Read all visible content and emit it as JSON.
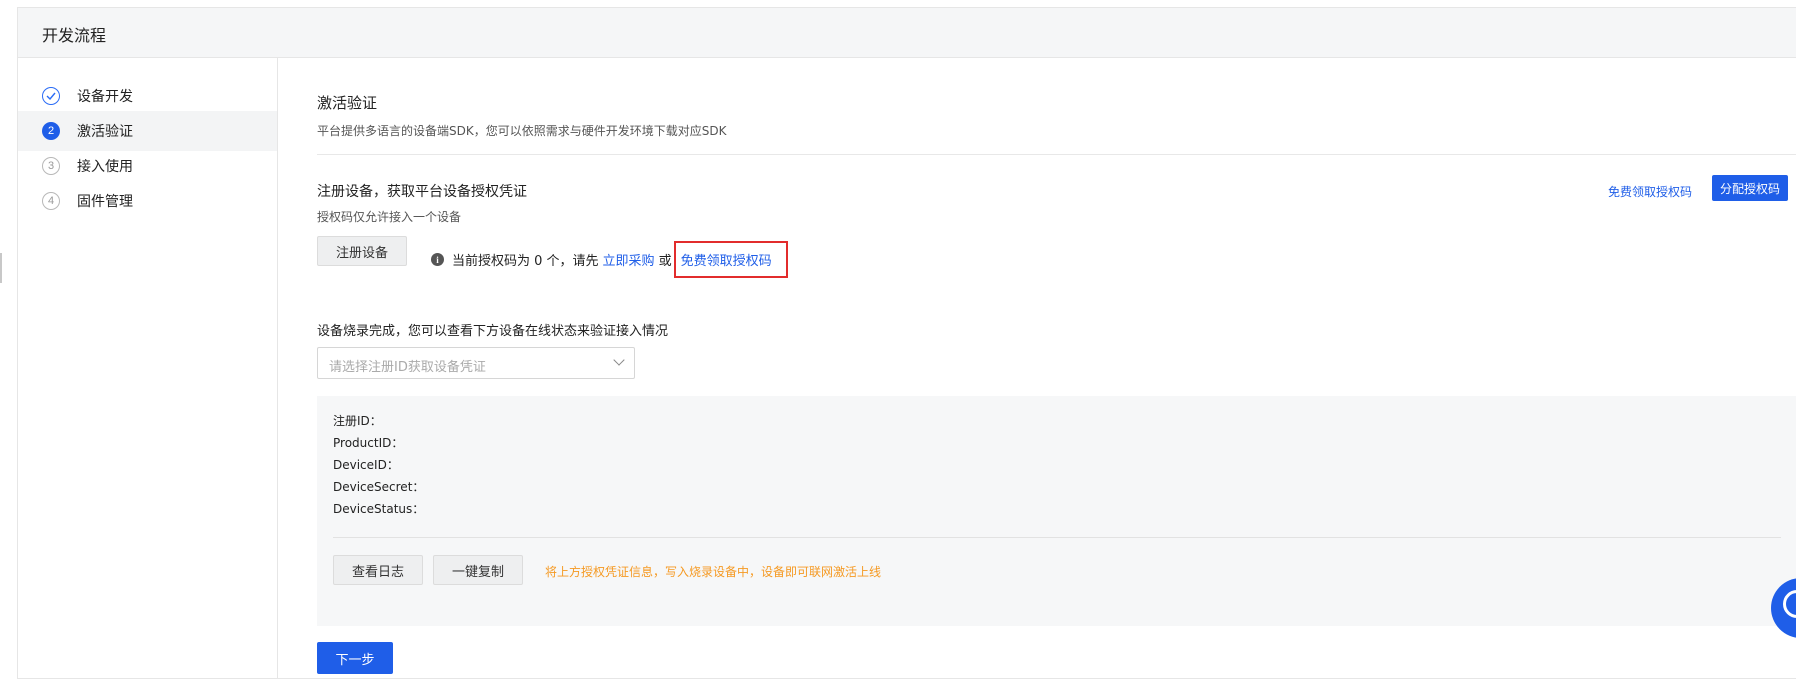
{
  "header": {
    "title": "开发流程"
  },
  "steps": [
    {
      "badge": "",
      "label": "设备开发",
      "state": "done"
    },
    {
      "badge": "2",
      "label": "激活验证",
      "state": "current"
    },
    {
      "badge": "3",
      "label": "接入使用",
      "state": "todo"
    },
    {
      "badge": "4",
      "label": "固件管理",
      "state": "todo"
    }
  ],
  "section": {
    "title": "激活验证",
    "desc": "平台提供多语言的设备端SDK，您可以依照需求与硬件开发环境下载对应SDK"
  },
  "register": {
    "title": "注册设备，获取平台设备授权凭证",
    "subtitle": "授权码仅允许接入一个设备",
    "free_link": "免费领取授权码",
    "assign_button": "分配授权码",
    "register_button": "注册设备",
    "info_prefix": "当前授权码为 0 个，请先",
    "buy_link": "立即采购",
    "or_text": "或",
    "free_link_inline": "免费领取授权码"
  },
  "burn": {
    "title": "设备烧录完成，您可以查看下方设备在线状态来验证接入情况",
    "select_placeholder": "请选择注册ID获取设备凭证"
  },
  "credentials": {
    "fields": [
      "注册ID：",
      "ProductID：",
      "DeviceID：",
      "DeviceSecret：",
      "DeviceStatus："
    ],
    "log_button": "查看日志",
    "copy_button": "一键复制",
    "hint": "将上方授权凭证信息，写入烧录设备中，设备即可联网激活上线"
  },
  "next_button": "下一步",
  "colors": {
    "primary": "#1f5ee8",
    "warning": "#f59a23",
    "highlight_border": "#e22c2c"
  }
}
